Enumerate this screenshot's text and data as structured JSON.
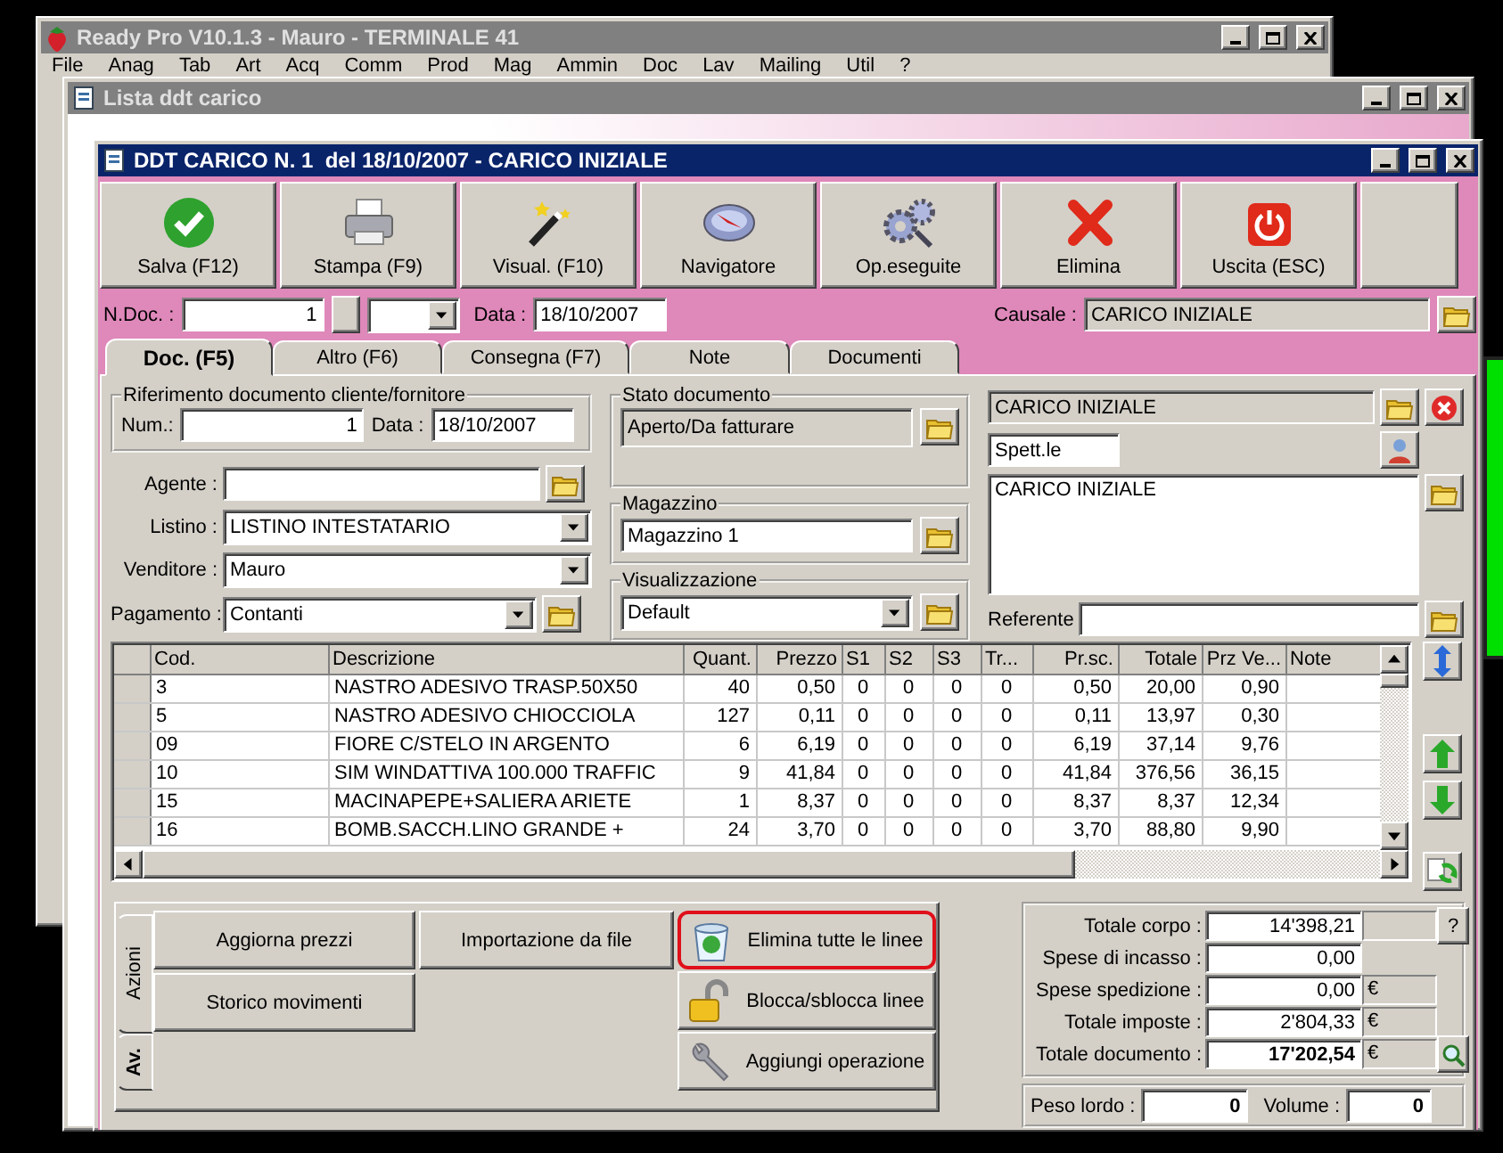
{
  "windows": [
    {
      "title": "Ready Pro V10.1.3 - Mauro - TERMINALE 41",
      "active": false,
      "menu": [
        "File",
        "Anag",
        "Tab",
        "Art",
        "Acq",
        "Comm",
        "Prod",
        "Mag",
        "Ammin",
        "Doc",
        "Lav",
        "Mailing",
        "Util",
        "?"
      ]
    },
    {
      "title": "Lista ddt carico",
      "active": false
    }
  ],
  "dialog": {
    "title": "DDT CARICO N. 1  del 18/10/2007 - CARICO INIZIALE",
    "active": true
  },
  "toolbar": [
    {
      "label": "Salva (F12)"
    },
    {
      "label": "Stampa (F9)"
    },
    {
      "label": "Visual. (F10)"
    },
    {
      "label": "Navigatore"
    },
    {
      "label": "Op.eseguite"
    },
    {
      "label": "Elimina"
    },
    {
      "label": "Uscita (ESC)"
    }
  ],
  "header": {
    "ndoc_label": "N.Doc. :",
    "ndoc": "1",
    "data_label": "Data :",
    "data": "18/10/2007",
    "causale_label": "Causale :",
    "causale": "CARICO INIZIALE"
  },
  "tabs": [
    {
      "label": "Doc. (F5)",
      "selected": true
    },
    {
      "label": "Altro (F6)",
      "selected": false
    },
    {
      "label": "Consegna (F7)",
      "selected": false
    },
    {
      "label": "Note",
      "selected": false
    },
    {
      "label": "Documenti",
      "selected": false
    }
  ],
  "riferimento": {
    "title": "Riferimento documento cliente/fornitore",
    "num_label": "Num.:",
    "num": "1",
    "data_label": "Data :",
    "data": "18/10/2007"
  },
  "fields": [
    {
      "label": "Agente :",
      "kind": "lookup"
    },
    {
      "label": "Listino :",
      "value": "LISTINO INTESTATARIO",
      "kind": "combo"
    },
    {
      "label": "Venditore :",
      "value": "Mauro",
      "kind": "combo"
    },
    {
      "label": "Pagamento :",
      "value": "Contanti",
      "kind": "combo_lookup"
    }
  ],
  "stato": {
    "title": "Stato documento",
    "value": "Aperto/Da fatturare"
  },
  "magazzino": {
    "title": "Magazzino",
    "value": "Magazzino 1"
  },
  "visualizzazione": {
    "title": "Visualizzazione",
    "value": "Default"
  },
  "intestatario": {
    "name": "CARICO INIZIALE",
    "title": "Spett.le",
    "address": "CARICO INIZIALE",
    "referente_label": "Referente"
  },
  "table": {
    "columns": [
      "Cod.",
      "Descrizione",
      "Quant.",
      "Prezzo",
      "S1",
      "S2",
      "S3",
      "Tr...",
      "Pr.sc.",
      "Totale",
      "Prz Ve...",
      "Note"
    ],
    "rows": [
      [
        "3",
        "NASTRO ADESIVO TRASP.50X50",
        "40",
        "0,50",
        "0",
        "0",
        "0",
        "0",
        "0,50",
        "20,00",
        "0,90"
      ],
      [
        "5",
        "NASTRO ADESIVO CHIOCCIOLA",
        "127",
        "0,11",
        "0",
        "0",
        "0",
        "0",
        "0,11",
        "13,97",
        "0,30"
      ],
      [
        "09",
        "FIORE C/STELO IN ARGENTO",
        "6",
        "6,19",
        "0",
        "0",
        "0",
        "0",
        "6,19",
        "37,14",
        "9,76"
      ],
      [
        "10",
        "SIM WINDATTIVA 100.000 TRAFFIC",
        "9",
        "41,84",
        "0",
        "0",
        "0",
        "0",
        "41,84",
        "376,56",
        "36,15"
      ],
      [
        "15",
        "MACINAPEPE+SALIERA ARIETE",
        "1",
        "8,37",
        "0",
        "0",
        "0",
        "0",
        "8,37",
        "8,37",
        "12,34"
      ],
      [
        "16",
        "BOMB.SACCH.LINO GRANDE +",
        "24",
        "3,70",
        "0",
        "0",
        "0",
        "0",
        "3,70",
        "88,80",
        "9,90"
      ]
    ]
  },
  "actions": {
    "tabs": [
      {
        "label": "Azioni",
        "selected": false
      },
      {
        "label": "Av.",
        "selected": true
      }
    ],
    "buttons": [
      "Aggiorna prezzi",
      "Importazione da file",
      "Storico movimenti"
    ],
    "icon_buttons": [
      {
        "label": "Elimina tutte le linee",
        "highlighted": true
      },
      {
        "label": "Blocca/sblocca linee",
        "highlighted": false
      },
      {
        "label": "Aggiungi operazione",
        "highlighted": false
      }
    ]
  },
  "totals": [
    {
      "label": "Totale corpo :",
      "value": "14'398,21",
      "kind": "help"
    },
    {
      "label": "Spese di incasso :",
      "value": "0,00",
      "kind": "plain"
    },
    {
      "label": "Spese spedizione :",
      "value": "0,00",
      "kind": "currency",
      "unit": "€"
    },
    {
      "label": "Totale imposte :",
      "value": "2'804,33",
      "kind": "currency",
      "unit": "€"
    },
    {
      "label": "Totale documento :",
      "value": "17'202,54",
      "kind": "grand",
      "unit": "€"
    }
  ],
  "help_label": "?",
  "peso": {
    "label": "Peso lordo :",
    "value": "0"
  },
  "volume": {
    "label": "Volume :",
    "value": "0"
  }
}
